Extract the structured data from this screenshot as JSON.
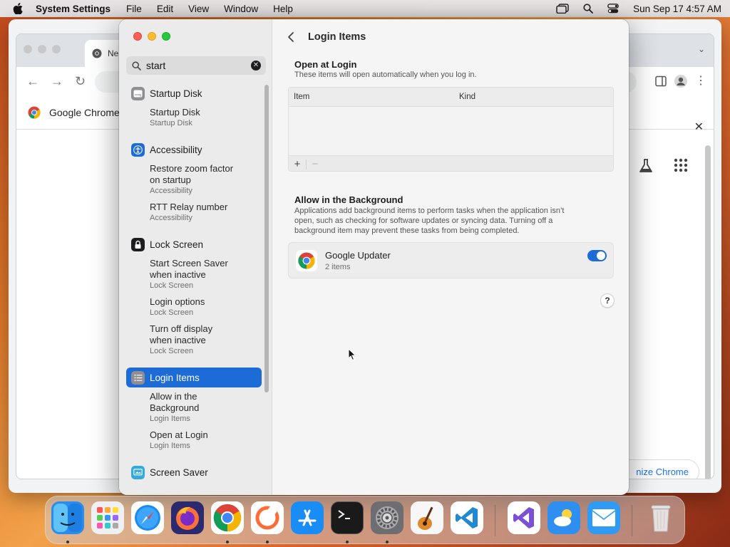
{
  "menubar": {
    "app_name": "System Settings",
    "menus": [
      "File",
      "Edit",
      "View",
      "Window",
      "Help"
    ],
    "clock": "Sun Sep 17  4:57 AM",
    "icons": [
      "apple-icon",
      "stage-manager-icon",
      "spotlight-icon",
      "control-center-icon"
    ]
  },
  "chrome": {
    "tab_label": "Ne",
    "bookmark_label": "Google Chrome",
    "customize_label": "nize Chrome",
    "brand_blue": "#1a73e8"
  },
  "settings": {
    "search": {
      "value": "start"
    },
    "results": [
      {
        "category": "Startup Disk",
        "icon": "startup-disk-icon",
        "icon_color": "#8e8e93",
        "items": [
          {
            "title": "Startup Disk",
            "category": "Startup Disk"
          }
        ]
      },
      {
        "category": "Accessibility",
        "icon": "accessibility-icon",
        "icon_color": "#1d6bd6",
        "items": [
          {
            "title_lines": [
              "Restore zoom factor",
              "on startup"
            ],
            "category": "Accessibility"
          },
          {
            "title": "RTT Relay number",
            "category": "Accessibility"
          }
        ]
      },
      {
        "category": "Lock Screen",
        "icon": "lock-icon",
        "icon_color": "#1d1d1f",
        "items": [
          {
            "title_lines": [
              "Start Screen Saver",
              "when inactive"
            ],
            "category": "Lock Screen"
          },
          {
            "title": "Login options",
            "category": "Lock Screen"
          },
          {
            "title_lines": [
              "Turn off display",
              "when inactive"
            ],
            "category": "Lock Screen"
          }
        ]
      },
      {
        "category": "Login Items",
        "icon": "list-icon",
        "icon_color": "#8e8e93",
        "selected": true,
        "items": [
          {
            "title_lines": [
              "Allow in the",
              "Background"
            ],
            "category": "Login Items"
          },
          {
            "title": "Open at Login",
            "category": "Login Items"
          }
        ]
      },
      {
        "category": "Screen Saver",
        "icon": "screen-saver-icon",
        "icon_color": "#34aadc",
        "items": []
      }
    ],
    "page_title": "Login Items",
    "open_at_login": {
      "title": "Open at Login",
      "description": "These items will open automatically when you log in.",
      "columns": [
        "Item",
        "Kind"
      ],
      "add_label": "+",
      "remove_label": "−"
    },
    "background": {
      "title": "Allow in the Background",
      "description_lines": [
        "Applications add background items to perform tasks when the application isn’t",
        "open, such as checking for software updates or syncing data. Turning off a",
        "background item may prevent these tasks from being completed."
      ],
      "app": {
        "name": "Google Updater",
        "count": "2 items",
        "enabled": true
      }
    },
    "help_label": "?",
    "accent": "#1d6bd6"
  },
  "dock": {
    "apps": [
      {
        "name": "finder-icon",
        "running": true
      },
      {
        "name": "launchpad-icon",
        "running": false
      },
      {
        "name": "safari-icon",
        "running": false
      },
      {
        "name": "firefox-icon",
        "running": false
      },
      {
        "name": "chrome-icon",
        "running": true
      },
      {
        "name": "postman-icon",
        "running": true
      },
      {
        "name": "app-store-icon",
        "running": false
      },
      {
        "name": "terminal-icon",
        "running": true
      },
      {
        "name": "system-settings-icon",
        "running": true
      },
      {
        "name": "garageband-icon",
        "running": false
      },
      {
        "name": "vscode-icon",
        "running": false
      },
      {
        "name": "visual-studio-icon",
        "running": false
      },
      {
        "name": "weather-icon",
        "running": false
      },
      {
        "name": "mail-icon",
        "running": false
      },
      {
        "name": "trash-icon",
        "running": false
      }
    ]
  }
}
